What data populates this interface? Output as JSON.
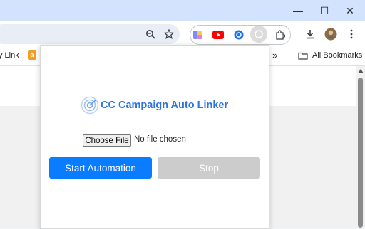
{
  "window": {
    "minimize_glyph": "—",
    "restore_glyph": "☐",
    "close_glyph": "✕"
  },
  "toolbar": {
    "icons": [
      "zoom-icon",
      "bookmark-star-icon",
      "download-icon",
      "profile-avatar",
      "more-menu-icon"
    ],
    "extensions": [
      "google-drive-icon",
      "youtube-icon",
      "extension-blue-icon",
      "cc-auto-linker-icon",
      "extensions-puzzle-icon"
    ]
  },
  "bookmarks": {
    "partial_item": "y Link",
    "overflow_label": "»",
    "all_bookmarks": "All Bookmarks"
  },
  "popup": {
    "title": "CC Campaign Auto Linker",
    "file_input": {
      "button_label": "Choose File",
      "status": "No file chosen"
    },
    "start_button": "Start Automation",
    "stop_button": "Stop",
    "colors": {
      "accent": "#0a7cff",
      "title": "#2f73e0",
      "disabled": "#cccccc"
    }
  }
}
